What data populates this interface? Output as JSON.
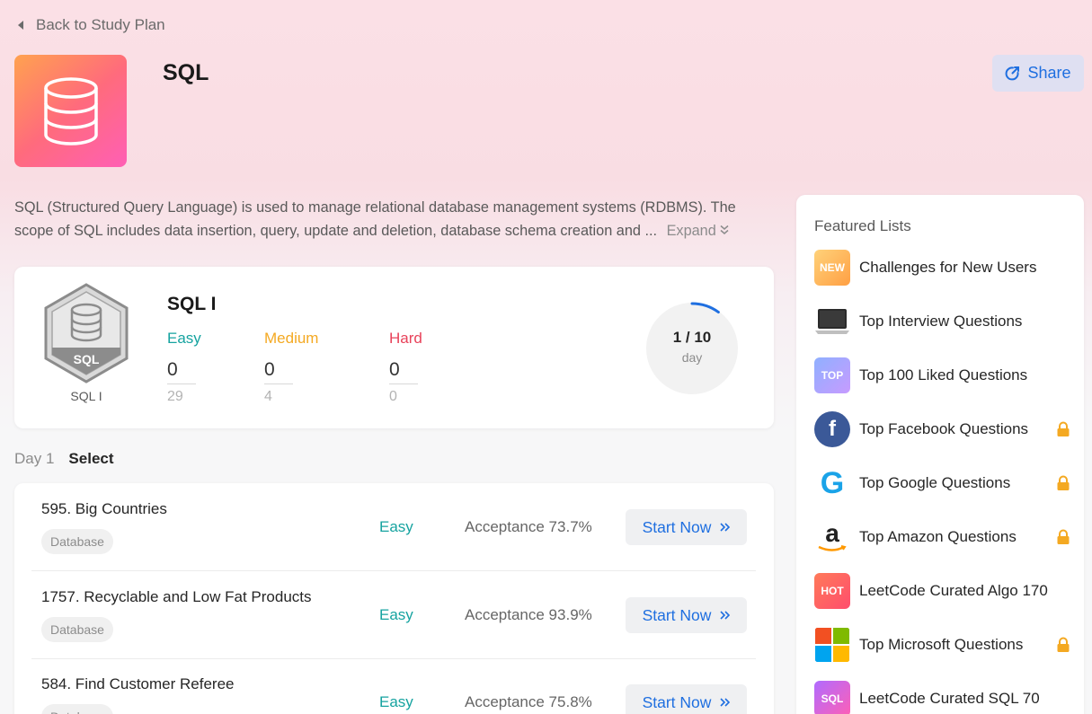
{
  "nav": {
    "back_label": "Back to Study Plan"
  },
  "header": {
    "title": "SQL",
    "share_label": "Share"
  },
  "description": {
    "text": "SQL (Structured Query Language) is used to manage relational database management systems (RDBMS). The scope of SQL includes data insertion, query, update and deletion, database schema creation and ...",
    "expand_label": "Expand"
  },
  "plan": {
    "badge_text": "SQL",
    "badge_caption": "SQL I",
    "name": "SQL I",
    "difficulties": [
      {
        "label": "Easy",
        "solved": "0",
        "total": "29",
        "color": "#16a3a0"
      },
      {
        "label": "Medium",
        "solved": "0",
        "total": "4",
        "color": "#f4a922"
      },
      {
        "label": "Hard",
        "solved": "0",
        "total": "0",
        "color": "#e8425a"
      }
    ],
    "progress": {
      "text": "1 / 10",
      "unit": "day",
      "current": 1,
      "total": 10
    }
  },
  "day": {
    "label": "Day 1",
    "select_label": "Select"
  },
  "questions": [
    {
      "title": "595. Big Countries",
      "tag": "Database",
      "difficulty": "Easy",
      "acceptance": "Acceptance 73.7%",
      "action": "Start Now"
    },
    {
      "title": "1757. Recyclable and Low Fat Products",
      "tag": "Database",
      "difficulty": "Easy",
      "acceptance": "Acceptance 93.9%",
      "action": "Start Now"
    },
    {
      "title": "584. Find Customer Referee",
      "tag": "Database",
      "difficulty": "Easy",
      "acceptance": "Acceptance 75.8%",
      "action": "Start Now"
    }
  ],
  "featured": {
    "title": "Featured Lists",
    "items": [
      {
        "label": "Challenges for New Users",
        "icon": "new-badge-icon",
        "icon_text": "NEW",
        "locked": false
      },
      {
        "label": "Top Interview Questions",
        "icon": "laptop-icon",
        "locked": false
      },
      {
        "label": "Top 100 Liked Questions",
        "icon": "top-badge-icon",
        "icon_text": "TOP",
        "locked": false
      },
      {
        "label": "Top Facebook Questions",
        "icon": "facebook-icon",
        "icon_text": "f",
        "locked": true
      },
      {
        "label": "Top Google Questions",
        "icon": "google-icon",
        "icon_text": "G",
        "locked": true
      },
      {
        "label": "Top Amazon Questions",
        "icon": "amazon-icon",
        "icon_text": "a",
        "locked": true
      },
      {
        "label": "LeetCode Curated Algo 170",
        "icon": "hot-badge-icon",
        "icon_text": "HOT",
        "locked": false
      },
      {
        "label": "Top Microsoft Questions",
        "icon": "microsoft-icon",
        "locked": true
      },
      {
        "label": "LeetCode Curated SQL 70",
        "icon": "sql-badge-icon",
        "icon_text": "SQL",
        "locked": false
      }
    ]
  },
  "colors": {
    "accent": "#1f6fe0",
    "easy": "#16a3a0",
    "medium": "#f4a922",
    "hard": "#e8425a",
    "lock": "#f4a922"
  }
}
